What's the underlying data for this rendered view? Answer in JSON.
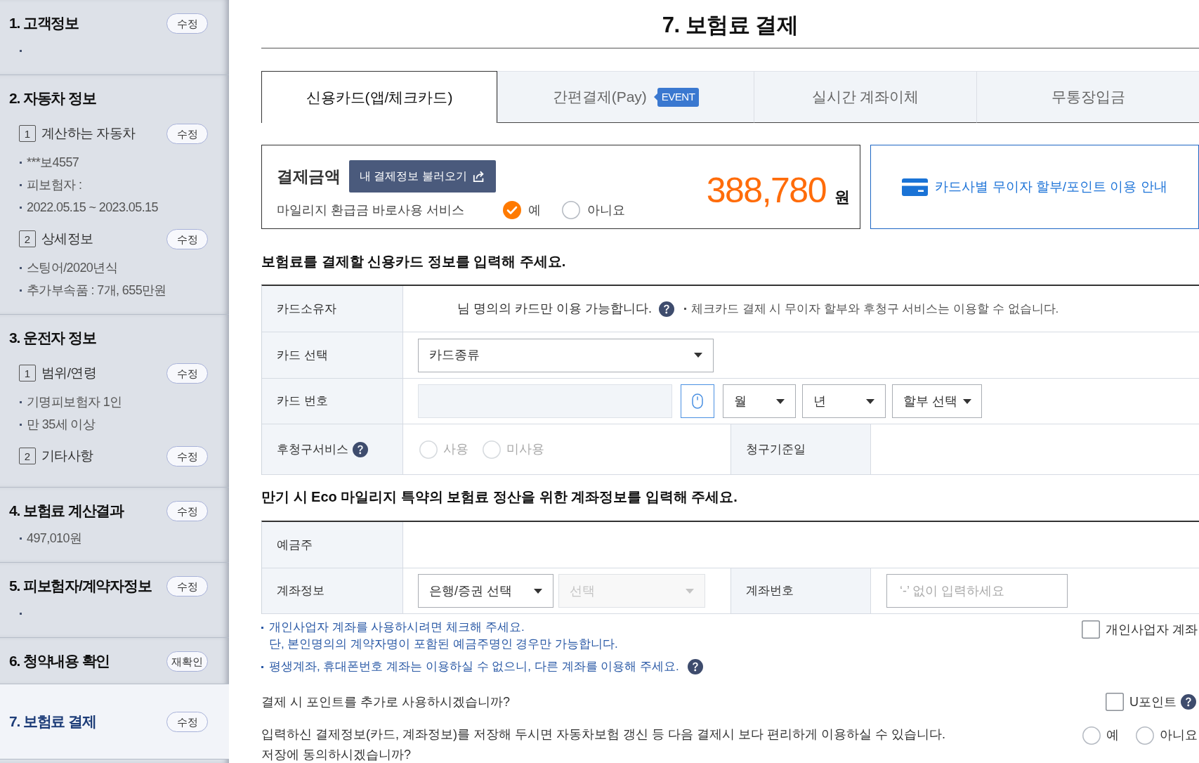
{
  "sidebar": {
    "sections": [
      {
        "title": "1. 고객정보",
        "button": "수정",
        "selected": false,
        "bullets": [
          {
            "kind": "blank"
          }
        ]
      },
      {
        "title": "2. 자동차 정보",
        "selected": false,
        "subsections": [
          {
            "number": "1",
            "title": "계산하는 자동차",
            "button": "수정",
            "bullets": [
              {
                "kind": "text",
                "text": "***보4557"
              },
              {
                "kind": "text",
                "text": "피보험자 :"
              },
              {
                "kind": "text",
                "text": "2022.05.15 ~ 2023.05.15"
              }
            ]
          },
          {
            "number": "2",
            "title": "상세정보",
            "button": "수정",
            "bullets": [
              {
                "kind": "text",
                "text": "스팅어/2020년식"
              },
              {
                "kind": "text",
                "text": "추가부속품 : 7개, 655만원"
              }
            ]
          }
        ]
      },
      {
        "title": "3. 운전자 정보",
        "selected": false,
        "subsections": [
          {
            "number": "1",
            "title": "범위/연령",
            "button": "수정",
            "bullets": [
              {
                "kind": "text",
                "text": "기명피보험자 1인"
              },
              {
                "kind": "text",
                "text": "만 35세 이상"
              }
            ]
          },
          {
            "number": "2",
            "title": "기타사항",
            "button": "수정"
          }
        ]
      },
      {
        "title": "4. 보험료 계산결과",
        "button": "수정",
        "selected": false,
        "bullets": [
          {
            "kind": "text",
            "text": "497,010원"
          }
        ]
      },
      {
        "title": "5. 피보험자/계약자정보",
        "button": "수정",
        "selected": false,
        "bullets": [
          {
            "kind": "blank"
          }
        ]
      },
      {
        "title": "6. 청약내용 확인",
        "button": "재확인",
        "selected": false
      },
      {
        "title": "7. 보험료 결제",
        "button": "수정",
        "selected": true
      }
    ]
  },
  "page_title": "7. 보험료 결제",
  "tabs": [
    {
      "label": "신용카드(앱/체크카드)",
      "selected": true
    },
    {
      "label": "간편결제(Pay)",
      "badge": "EVENT",
      "selected": false
    },
    {
      "label": "실시간 계좌이체",
      "selected": false
    },
    {
      "label": "무통장입금",
      "selected": false
    }
  ],
  "payment_summary": {
    "label": "결제금액",
    "load_button": "내 결제정보 불러오기",
    "amount": "388,780",
    "currency": "원",
    "mileage_label": "마일리지 환급금 바로사용 서비스",
    "mileage_options": [
      {
        "label": "예",
        "selected": true
      },
      {
        "label": "아니요",
        "selected": false
      }
    ]
  },
  "card_guide_link": {
    "label": "카드사별 무이자 할부/포인트 이용 안내"
  },
  "card_form": {
    "heading": "보험료를 결제할 신용카드 정보를 입력해 주세요.",
    "owner": {
      "label": "카드소유자",
      "text": "님 명의의 카드만 이용 가능합니다.",
      "note": "체크카드 결제 시 무이자 할부와 후청구 서비스는 이용할 수 없습니다."
    },
    "card_select": {
      "label": "카드 선택",
      "value": "카드종류"
    },
    "card_number": {
      "label": "카드 번호",
      "month": "월",
      "year": "년",
      "installment": "할부 선택"
    },
    "deferred": {
      "label": "후청구서비스",
      "options": [
        {
          "label": "사용",
          "selected": false,
          "disabled": true
        },
        {
          "label": "미사용",
          "selected": false,
          "disabled": true
        }
      ],
      "billing_date_label": "청구기준일"
    }
  },
  "account_form": {
    "heading": "만기 시 Eco 마일리지 특약의 보험료 정산을 위한 계좌정보를 입력해 주세요.",
    "holder": {
      "label": "예금주"
    },
    "account": {
      "label": "계좌정보",
      "selects": [
        {
          "value": "은행/증권 선택",
          "disabled": false
        },
        {
          "value": "선택",
          "disabled": true
        }
      ],
      "number_label": "계좌번호",
      "number_placeholder": "‘-’ 없이 입력하세요"
    }
  },
  "account_notes": [
    {
      "lines": [
        "개인사업자 계좌를 사용하시려면 체크해 주세요.",
        "단, 본인명의의 계약자명이 포함된 예금주명인 경우만 가능합니다."
      ]
    },
    {
      "lines": [
        "평생계좌, 휴대폰번호 계좌는 이용하실 수 없으니, 다른 계좌를 이용해 주세요."
      ],
      "help": true
    }
  ],
  "business_account": {
    "label": "개인사업자 계좌",
    "checked": false
  },
  "points": {
    "question": "결제 시 포인트를 추가로 사용하시겠습니까?",
    "option": {
      "label": "U포인트",
      "checked": false
    }
  },
  "save_consent": {
    "lines": [
      "입력하신 결제정보(카드, 계좌정보)를 저장해 두시면 자동차보험 갱신 등 다음 결제시 보다 편리하게 이용하실 수 있습니다.",
      "저장에 동의하시겠습니까?"
    ],
    "options": [
      {
        "label": "예",
        "selected": false
      },
      {
        "label": "아니요",
        "selected": false
      }
    ]
  }
}
